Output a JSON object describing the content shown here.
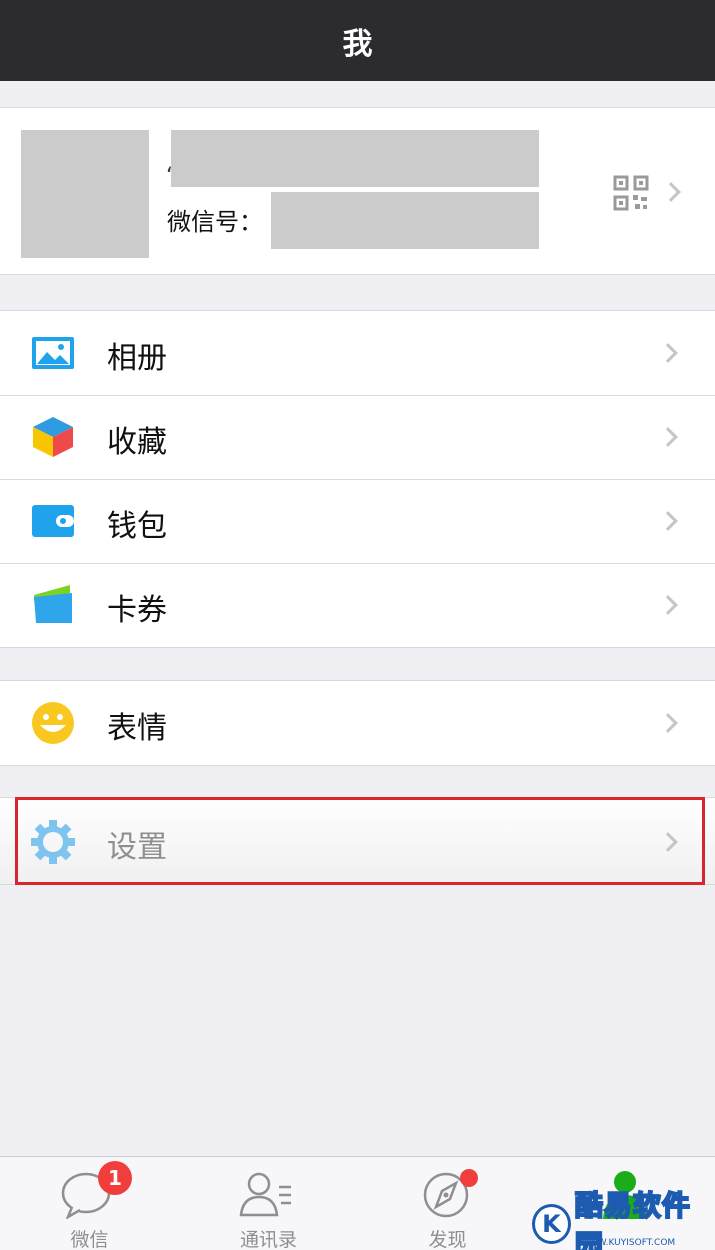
{
  "nav": {
    "title": "我"
  },
  "profile": {
    "name_partial": "‘",
    "wechat_id_label": "微信号："
  },
  "menu_group_1": [
    {
      "label": "相册",
      "icon": "album-icon"
    },
    {
      "label": "收藏",
      "icon": "favorites-icon"
    },
    {
      "label": "钱包",
      "icon": "wallet-icon"
    },
    {
      "label": "卡券",
      "icon": "cards-icon"
    }
  ],
  "menu_group_2": [
    {
      "label": "表情",
      "icon": "sticker-smiley-icon"
    }
  ],
  "menu_group_3": [
    {
      "label": "设置",
      "icon": "gear-icon"
    }
  ],
  "tabbar": {
    "tabs": [
      {
        "label": "微信",
        "badge": "1"
      },
      {
        "label": "通讯录"
      },
      {
        "label": "发现"
      },
      {
        "label": ""
      }
    ]
  },
  "watermark": {
    "letter": "K",
    "text": "酷易软件园",
    "url": "WWW.KUYISOFT.COM"
  },
  "colors": {
    "nav_bg": "#2b2b30",
    "accent_green": "#1aad19",
    "badge_red": "#f23d3d",
    "highlight_red": "#d9252b"
  }
}
